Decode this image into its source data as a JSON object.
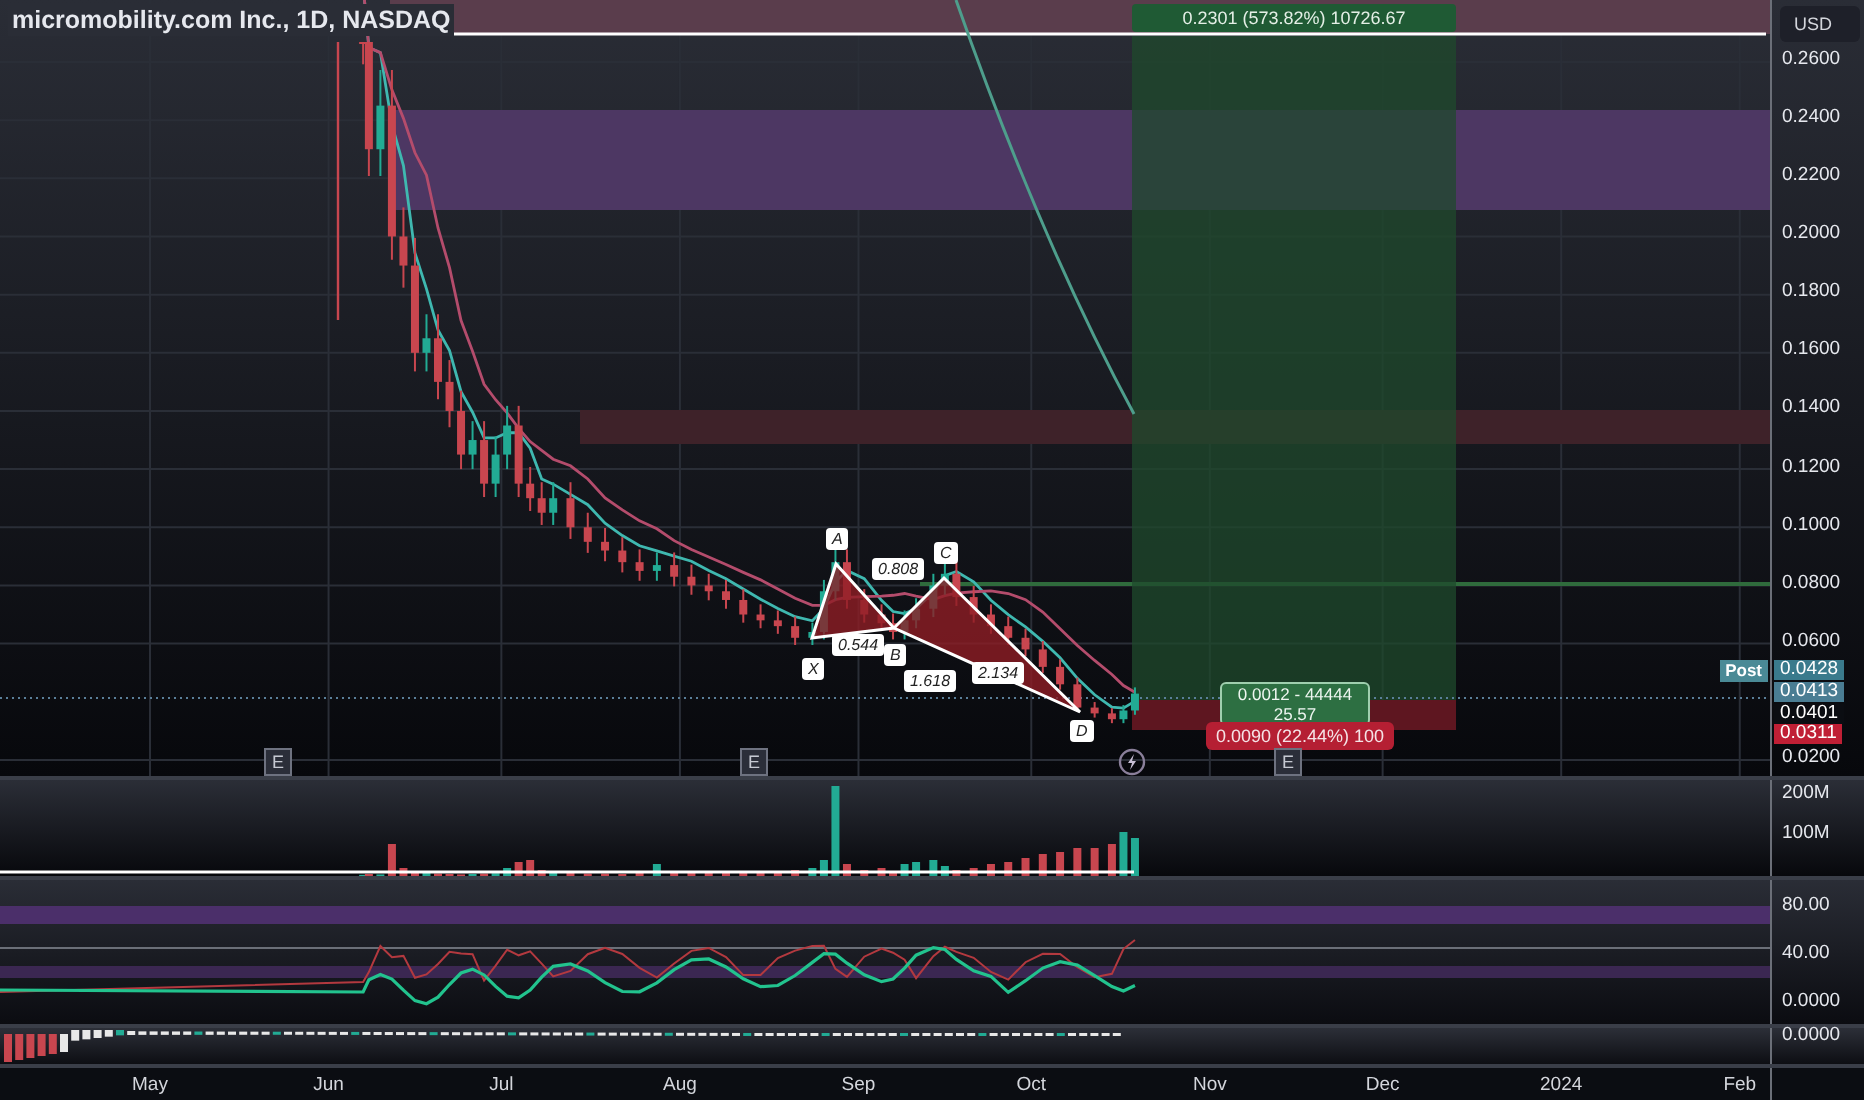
{
  "title": "micromobility.com Inc., 1D, NASDAQ",
  "currency_button": "USD",
  "price_axis": [
    "0.2600",
    "0.2400",
    "0.2200",
    "0.2000",
    "0.1800",
    "0.1600",
    "0.1400",
    "0.1200",
    "0.1000",
    "0.0800",
    "0.0600",
    "0.0200"
  ],
  "price_labels": [
    {
      "kind": "post",
      "tag": "Post",
      "value": "0.0428"
    },
    {
      "kind": "last",
      "value": "0.0413"
    },
    {
      "kind": "plain",
      "value": "0.0401"
    },
    {
      "kind": "stop",
      "value": "0.0311"
    }
  ],
  "pattern": {
    "points": [
      "X",
      "A",
      "B",
      "C",
      "D"
    ],
    "ratios": [
      "0.808",
      "0.544",
      "1.618",
      "2.134"
    ]
  },
  "position": {
    "target_label": "0.2301 (573.82%) 10726.67",
    "center_lines": [
      "0.0012 - 44444",
      "25.57"
    ],
    "stop_label": "0.0090 (22.44%) 100"
  },
  "earnings_markers": [
    "E",
    "E",
    "E"
  ],
  "volume_axis": [
    "200M",
    "100M"
  ],
  "rsi_axis": [
    "80.00",
    "40.00",
    "0.0000"
  ],
  "macd_axis": [
    "0.0000"
  ],
  "time_axis": [
    "May",
    "Jun",
    "Jul",
    "Aug",
    "Sep",
    "Oct",
    "Nov",
    "Dec",
    "2024",
    "Feb"
  ]
}
